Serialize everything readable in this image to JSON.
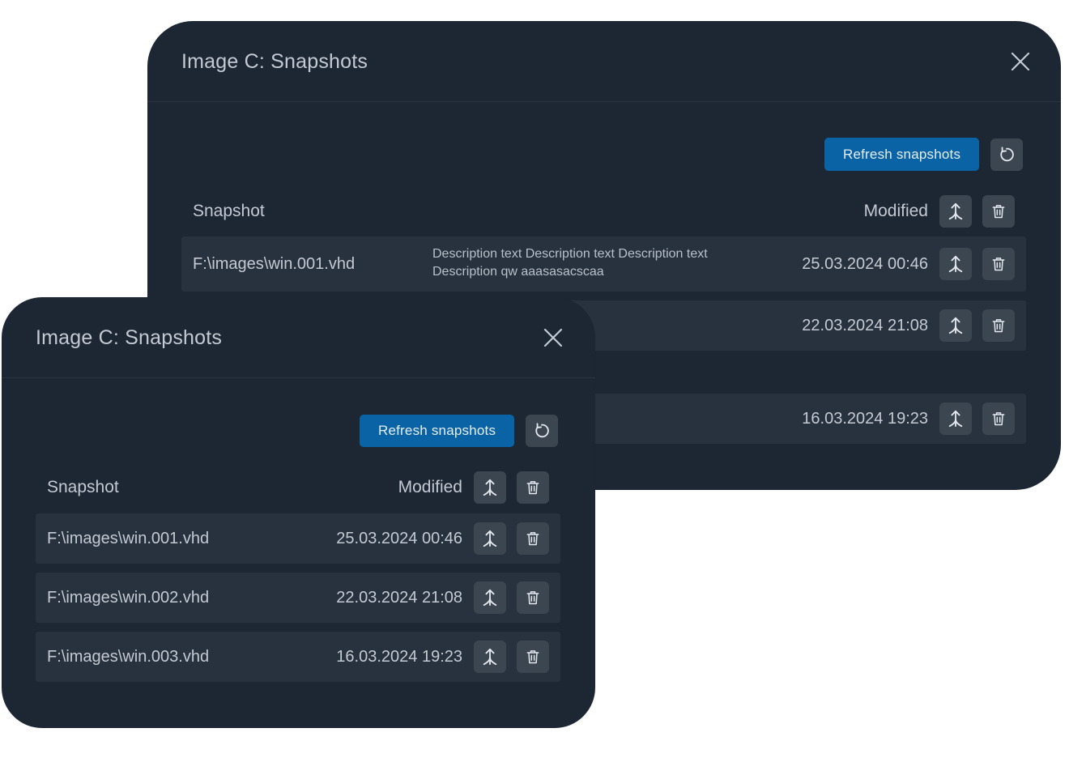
{
  "dialogs": {
    "back": {
      "title": "Image C: Snapshots",
      "refresh_label": "Refresh snapshots",
      "columns": {
        "snapshot": "Snapshot",
        "modified": "Modified"
      },
      "rows": [
        {
          "path": "F:\\images\\win.001.vhd",
          "description": "Description text Description text Description text Description qw  aaasasacscaa",
          "modified": "25.03.2024 00:46"
        },
        {
          "path": "",
          "description": "",
          "modified": "22.03.2024 21:08"
        },
        {
          "path": "",
          "description": "",
          "modified": "16.03.2024 19:23"
        }
      ]
    },
    "front": {
      "title": "Image C: Snapshots",
      "refresh_label": "Refresh snapshots",
      "columns": {
        "snapshot": "Snapshot",
        "modified": "Modified"
      },
      "rows": [
        {
          "path": "F:\\images\\win.001.vhd",
          "modified": "25.03.2024 00:46"
        },
        {
          "path": "F:\\images\\win.002.vhd",
          "modified": "22.03.2024 21:08"
        },
        {
          "path": "F:\\images\\win.003.vhd",
          "modified": "16.03.2024 19:23"
        }
      ]
    }
  },
  "icons": {
    "close": "close-icon",
    "reload": "reload-icon",
    "merge": "merge-icon",
    "delete": "trash-icon"
  },
  "colors": {
    "dialog_bg": "#1d2733",
    "row_bg": "#28323e",
    "primary_button": "#0a63a5",
    "icon_button": "#3b4651"
  }
}
